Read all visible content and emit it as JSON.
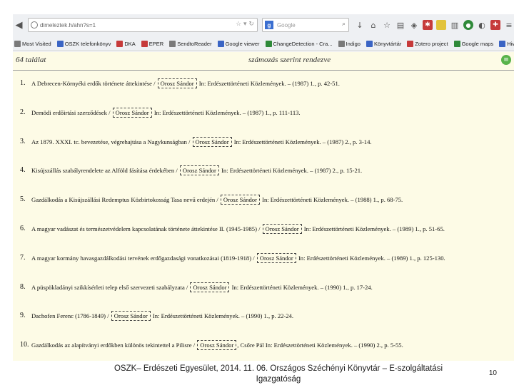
{
  "browser": {
    "url": "dimeleztek.h/ahn?s=1",
    "search_engine_badge": "g",
    "search_placeholder": "Google",
    "bookmarks": [
      {
        "label": "Most Visited",
        "color": "#7a7a7a"
      },
      {
        "label": "OSZK telefonkönyv",
        "color": "#3a64c4"
      },
      {
        "label": "DKA",
        "color": "#c63a3a"
      },
      {
        "label": "EPER",
        "color": "#c63a3a"
      },
      {
        "label": "SendtoReader",
        "color": "#7a7a7a"
      },
      {
        "label": "Google viewer",
        "color": "#3a64c4"
      },
      {
        "label": "ChangeDetection - Cra...",
        "color": "#2f8a3a"
      },
      {
        "label": "Indigo",
        "color": "#7a7a7a"
      },
      {
        "label": "Könyvtártár",
        "color": "#3a64c4"
      },
      {
        "label": "Zotero project",
        "color": "#c63a3a"
      },
      {
        "label": "Google maps",
        "color": "#2f8a3a"
      },
      {
        "label": "Hivatkozások testreszá...",
        "color": "#3a64c4"
      },
      {
        "label": "MEK",
        "color": "#3a64c4"
      }
    ]
  },
  "results": {
    "count": "64 találat",
    "sort": "számozás szerint rendezve",
    "items": [
      {
        "num": "1.",
        "before": "A Debrecen-Környéki erdők története áttekintése / ",
        "author": "Orosz Sándor",
        "after": " In: Erdészettörténeti Közlemények. – (1987) 1., p. 42-51."
      },
      {
        "num": "2.",
        "before": "Demödi erdőirtási szerződések / ",
        "author": "Orosz Sándor",
        "after": " In: Erdészettörténeti Közlemények. – (1987) 1., p. 111-113."
      },
      {
        "num": "3.",
        "before": "Az 1879. XXXI. tc. bevezetése, végrehajtása a Nagykunságban / ",
        "author": "Orosz Sándor",
        "after": " In: Erdészettörténeti Közlemények. – (1987) 2., p. 3-14."
      },
      {
        "num": "4.",
        "before": "Kisújszállás szabályrendelete az Alföld fásítása érdekében / ",
        "author": "Orosz Sándor",
        "after": " In: Erdészettörténeti Közlemények. – (1987) 2., p. 15-21."
      },
      {
        "num": "5.",
        "before": "Gazdálkodás a Kisújszállási Redemptus Közbirtokosság Tasa nevű erdején / ",
        "author": "Orosz Sándor",
        "after": " In: Erdészettörténeti Közlemények. – (1988) 1., p. 68-75."
      },
      {
        "num": "6.",
        "before": "A magyar vadászat és természetvédelem kapcsolatának története áttekintése II. (1945-1985) / ",
        "author": "Orosz Sándor",
        "after": " In: Erdészettörténeti Közlemények. – (1989) 1., p. 51-65."
      },
      {
        "num": "7.",
        "before": "A magyar kormány havasgazdálkodási tervének erdőgazdasági vonatkozásai (1819-1918) / ",
        "author": "Orosz Sándor",
        "after": " In: Erdészettörténeti Közlemények. – (1989) 1., p. 125-130."
      },
      {
        "num": "8.",
        "before": "A püspökladányi szikkísérleti telep első szervezeti szabályzata / ",
        "author": "Orosz Sándor",
        "after": " In: Erdészettörténeti Közlemények. – (1990) 1., p. 17-24."
      },
      {
        "num": "9.",
        "before": "Dachofen Ferenc (1786-1849) / ",
        "author": "Orosz Sándor",
        "after": " In: Erdészettörténeti Közlemények. – (1990) 1., p. 22-24."
      },
      {
        "num": "10.",
        "before": "Gazdálkodás az alapítványi erdőkben különös tekintettel a Pilisre / ",
        "author": "Orosz Sándor",
        "after": ", Csőre Pál In: Erdészettörténeti Közlemények. – (1990) 2., p. 5-55."
      }
    ]
  },
  "footer": {
    "text": "OSZK– Erdészeti Egyesület, 2014. 11. 06. Országos Széchényi Könyvtár – E-szolgáltatási Igazgatóság",
    "page": "10"
  },
  "colors": {
    "page_background": "#fdfbe6",
    "chrome_background": "#eef0f3"
  }
}
